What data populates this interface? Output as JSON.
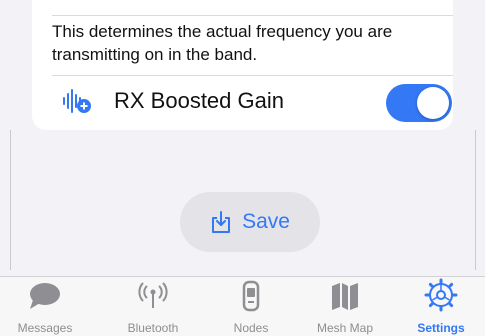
{
  "setting": {
    "description": "This determines the actual frequency you are transmitting on in the band.",
    "toggle_label": "RX Boosted Gain",
    "toggle_on": true,
    "icon": "waveform-plus-icon"
  },
  "save_button": {
    "label": "Save",
    "icon": "save-download-icon"
  },
  "tabs": [
    {
      "label": "Messages",
      "icon": "chat-bubble-icon",
      "active": false
    },
    {
      "label": "Bluetooth",
      "icon": "antenna-icon",
      "active": false
    },
    {
      "label": "Nodes",
      "icon": "device-icon",
      "active": false
    },
    {
      "label": "Mesh Map",
      "icon": "map-icon",
      "active": false
    },
    {
      "label": "Settings",
      "icon": "gear-icon",
      "active": true
    }
  ],
  "colors": {
    "accent": "#3478f6",
    "inactive": "#8e8e93",
    "background": "#f2f2f7"
  }
}
